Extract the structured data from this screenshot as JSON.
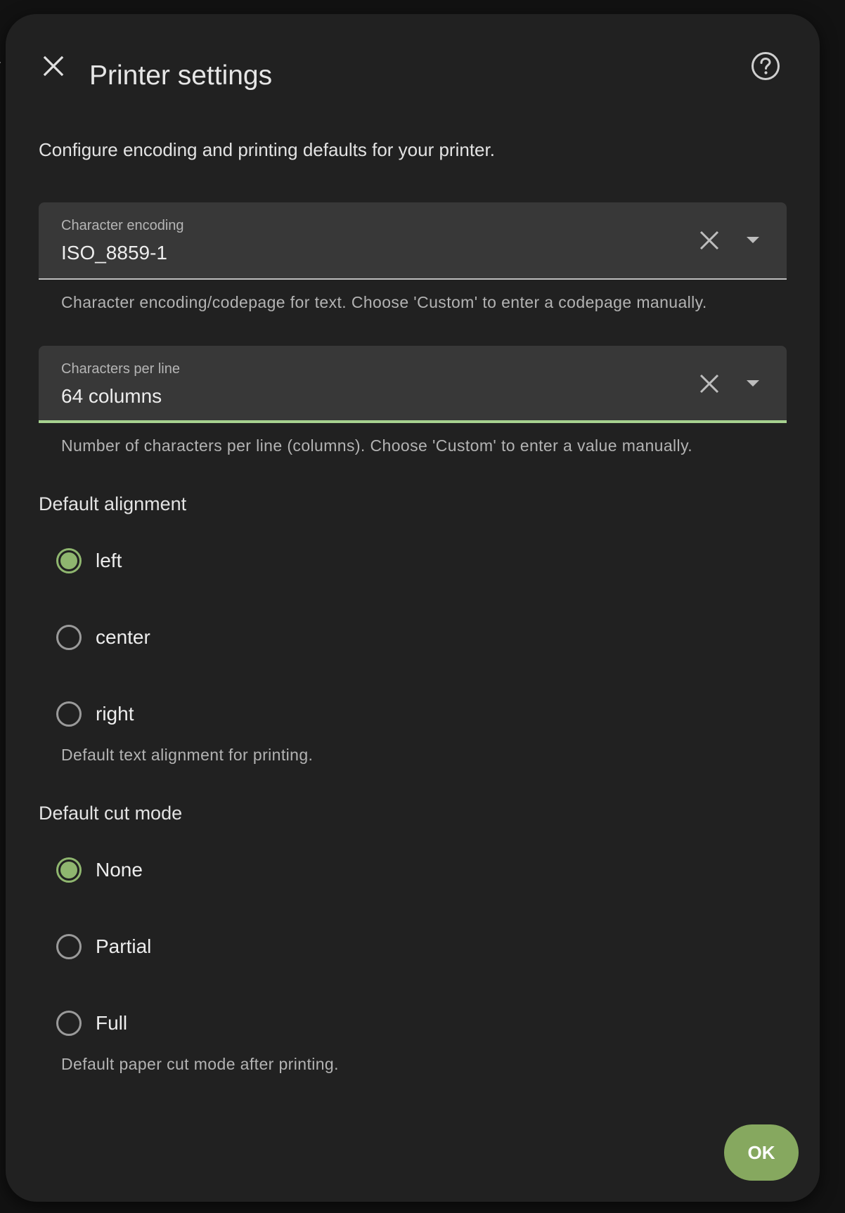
{
  "backdrop": {
    "text_fragment": "r"
  },
  "dialog": {
    "title": "Printer settings",
    "close_icon": "close-icon",
    "help_icon": "help-circle-icon",
    "description": "Configure encoding and printing defaults for your printer."
  },
  "encoding": {
    "label": "Character encoding",
    "value": "ISO_8859-1",
    "helper": "Character encoding/codepage for text. Choose 'Custom' to enter a codepage manually."
  },
  "columns": {
    "label": "Characters per line",
    "value": "64 columns",
    "helper": "Number of characters per line (columns). Choose 'Custom' to enter a value manually."
  },
  "alignment": {
    "title": "Default alignment",
    "options": [
      {
        "label": "left",
        "checked": true
      },
      {
        "label": "center",
        "checked": false
      },
      {
        "label": "right",
        "checked": false
      }
    ],
    "helper": "Default text alignment for printing."
  },
  "cut_mode": {
    "title": "Default cut mode",
    "options": [
      {
        "label": "None",
        "checked": true
      },
      {
        "label": "Partial",
        "checked": false
      },
      {
        "label": "Full",
        "checked": false
      }
    ],
    "helper": "Default paper cut mode after printing."
  },
  "actions": {
    "ok_label": "OK"
  },
  "colors": {
    "accent": "#8fb66f",
    "button": "#86a85f",
    "surface": "#212121",
    "field": "#383838"
  }
}
